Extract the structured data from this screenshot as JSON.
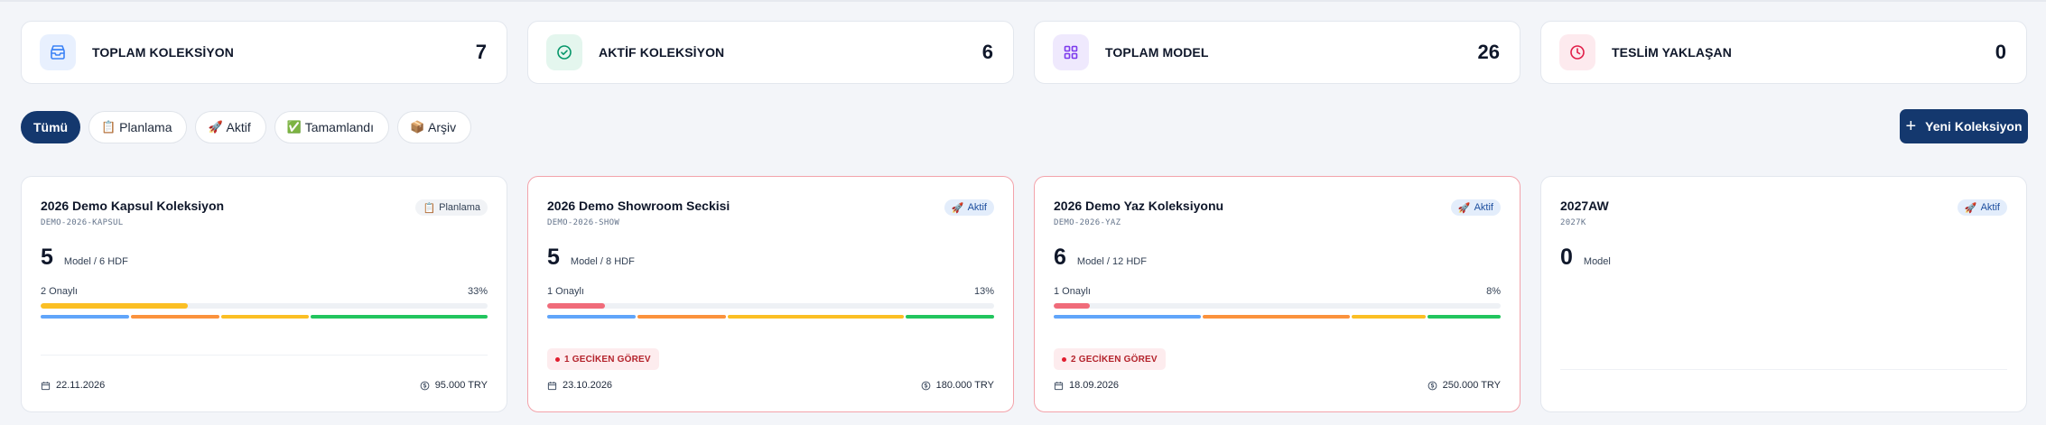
{
  "stats": [
    {
      "label": "TOPLAM KOLEKSİYON",
      "value": "7",
      "icon": "inbox-icon",
      "color": "#3b82f6",
      "bg": "#e8f0fe"
    },
    {
      "label": "AKTİF KOLEKSİYON",
      "value": "6",
      "icon": "check-circle-icon",
      "color": "#059669",
      "bg": "#e4f6ee"
    },
    {
      "label": "TOPLAM MODEL",
      "value": "26",
      "icon": "grid-icon",
      "color": "#7c3aed",
      "bg": "#efe9fd"
    },
    {
      "label": "TESLİM YAKLAŞAN",
      "value": "0",
      "icon": "clock-icon",
      "color": "#e11d48",
      "bg": "#fdeaee"
    }
  ],
  "filters": [
    {
      "label": "Tümü",
      "emoji": "",
      "active": true
    },
    {
      "label": "Planlama",
      "emoji": "📋",
      "active": false
    },
    {
      "label": "Aktif",
      "emoji": "🚀",
      "active": false
    },
    {
      "label": "Tamamlandı",
      "emoji": "✅",
      "active": false
    },
    {
      "label": "Arşiv",
      "emoji": "📦",
      "active": false
    }
  ],
  "new_button": {
    "label": "Yeni Koleksiyon"
  },
  "cards": [
    {
      "title": "2026 Demo Kapsul Koleksiyon",
      "code": "DEMO-2026-KAPSUL",
      "status": "Planlama",
      "status_emoji": "📋",
      "status_type": "planlama",
      "count": "5",
      "count_text": "Model / 6 HDF",
      "approved": "2 Onaylı",
      "percent": "33%",
      "progress": 0.33,
      "progress_color": "#fbbf24",
      "stages": [
        {
          "flex": 1,
          "color": "#60a5fa"
        },
        {
          "flex": 1,
          "color": "#fb923c"
        },
        {
          "flex": 1,
          "color": "#fbbf24"
        },
        {
          "flex": 2,
          "color": "#22c55e"
        }
      ],
      "late": "",
      "date": "22.11.2026",
      "amount": "95.000 TRY"
    },
    {
      "title": "2026 Demo Showroom Seckisi",
      "code": "DEMO-2026-SHOW",
      "status": "Aktif",
      "status_emoji": "🚀",
      "status_type": "aktif",
      "count": "5",
      "count_text": "Model / 8 HDF",
      "approved": "1 Onaylı",
      "percent": "13%",
      "progress": 0.13,
      "progress_color": "#f06b7a",
      "stages": [
        {
          "flex": 1,
          "color": "#60a5fa"
        },
        {
          "flex": 1,
          "color": "#fb923c"
        },
        {
          "flex": 2,
          "color": "#fbbf24"
        },
        {
          "flex": 1,
          "color": "#22c55e"
        }
      ],
      "late": "1 GECİKEN GÖREV",
      "date": "23.10.2026",
      "amount": "180.000 TRY"
    },
    {
      "title": "2026 Demo Yaz Koleksiyonu",
      "code": "DEMO-2026-YAZ",
      "status": "Aktif",
      "status_emoji": "🚀",
      "status_type": "aktif",
      "count": "6",
      "count_text": "Model / 12 HDF",
      "approved": "1 Onaylı",
      "percent": "8%",
      "progress": 0.08,
      "progress_color": "#f06b7a",
      "stages": [
        {
          "flex": 2,
          "color": "#60a5fa"
        },
        {
          "flex": 2,
          "color": "#fb923c"
        },
        {
          "flex": 1,
          "color": "#fbbf24"
        },
        {
          "flex": 1,
          "color": "#22c55e"
        }
      ],
      "late": "2 GECİKEN GÖREV",
      "date": "18.09.2026",
      "amount": "250.000 TRY"
    },
    {
      "title": "2027AW",
      "code": "2027K",
      "status": "Aktif",
      "status_emoji": "🚀",
      "status_type": "aktif",
      "count": "0",
      "count_text": "Model",
      "approved": "",
      "percent": "",
      "progress": 0,
      "progress_color": "",
      "stages": [],
      "late": "",
      "date": "",
      "amount": ""
    }
  ]
}
